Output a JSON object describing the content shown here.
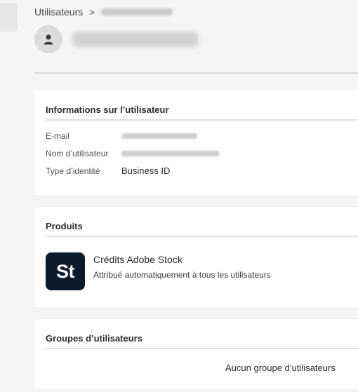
{
  "breadcrumb": {
    "root": "Utilisateurs",
    "separator": ">"
  },
  "user_icon": "user-icon",
  "info_card": {
    "title": "Informations sur l’utilisateur",
    "rows": [
      {
        "label": "E-mail",
        "value": ""
      },
      {
        "label": "Nom d’utilisateur",
        "value": ""
      },
      {
        "label": "Type d’identité",
        "value": "Business ID"
      }
    ]
  },
  "products_card": {
    "title": "Produits",
    "items": [
      {
        "icon_text": "St",
        "icon_color": "#0b1b2c",
        "name": "Crédits Adobe Stock",
        "description": "Attribué automatiquement à tous les utilisateurs"
      }
    ]
  },
  "groups_card": {
    "title": "Groupes d’utilisateurs",
    "empty_text": "Aucun groupe d’utilisateurs"
  }
}
